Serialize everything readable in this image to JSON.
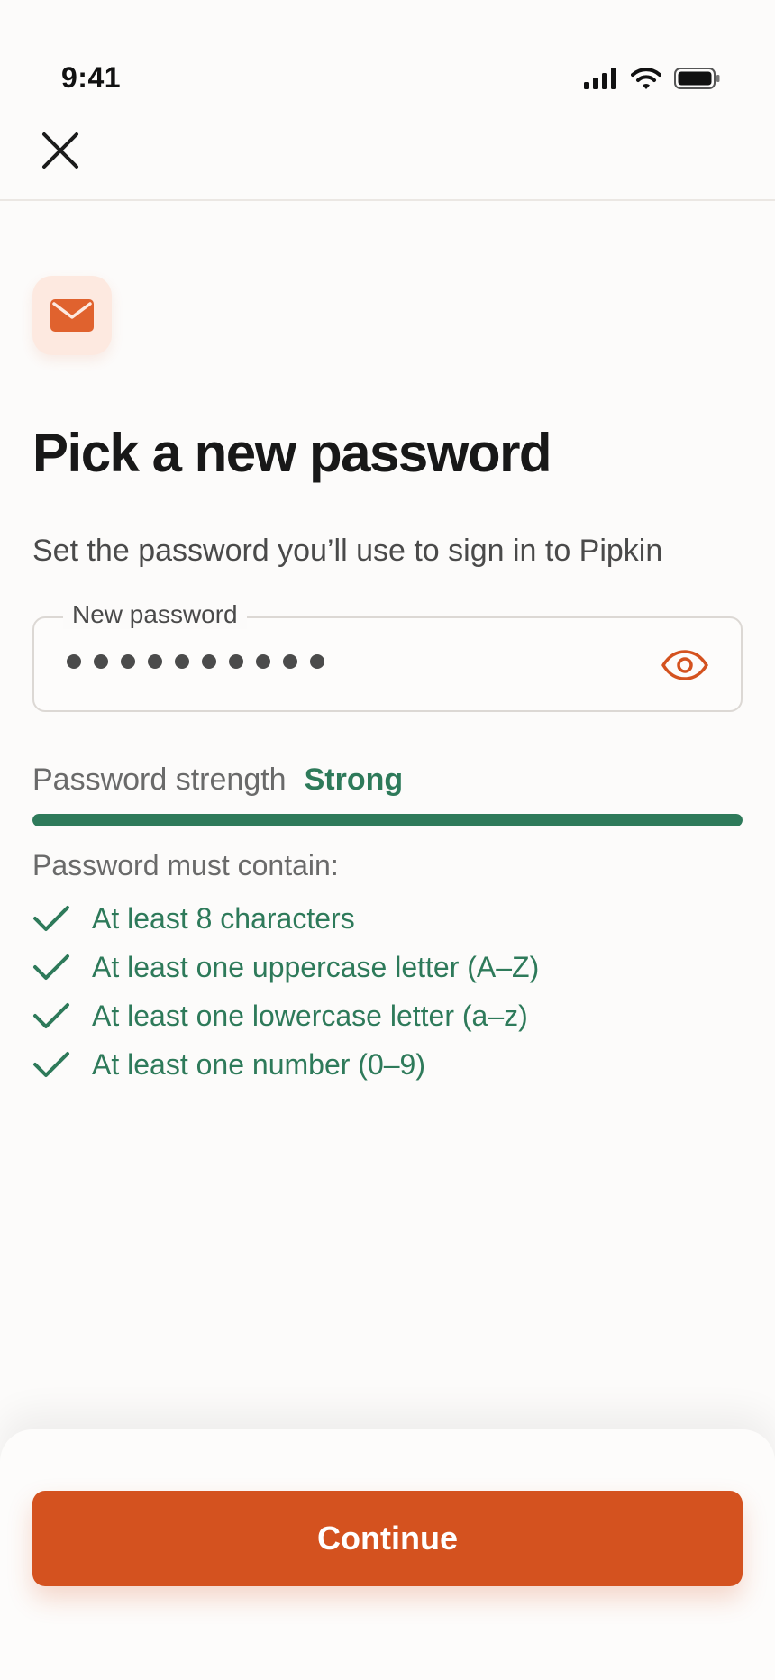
{
  "status_bar": {
    "time": "9:41"
  },
  "header": {
    "close_icon": "close-icon"
  },
  "hero": {
    "icon": "mail-icon",
    "title": "Pick a new password",
    "subtitle": "Set the password you’ll use to sign in to Pipkin"
  },
  "password_field": {
    "label": "New password",
    "masked_length": 10,
    "toggle_icon": "eye-icon"
  },
  "strength": {
    "label": "Password strength",
    "value": "Strong",
    "level": 1.0
  },
  "requirements": {
    "title": "Password must contain:",
    "items": [
      {
        "text": "At least 8 characters",
        "met": true
      },
      {
        "text": "At least one uppercase letter (A–Z)",
        "met": true
      },
      {
        "text": "At least one lowercase letter (a–z)",
        "met": true
      },
      {
        "text": "At least one number (0–9)",
        "met": true
      }
    ]
  },
  "footer": {
    "continue_label": "Continue"
  },
  "colors": {
    "accent": "#d4521f",
    "success": "#2e7a5a",
    "background": "#fcfbfa"
  }
}
